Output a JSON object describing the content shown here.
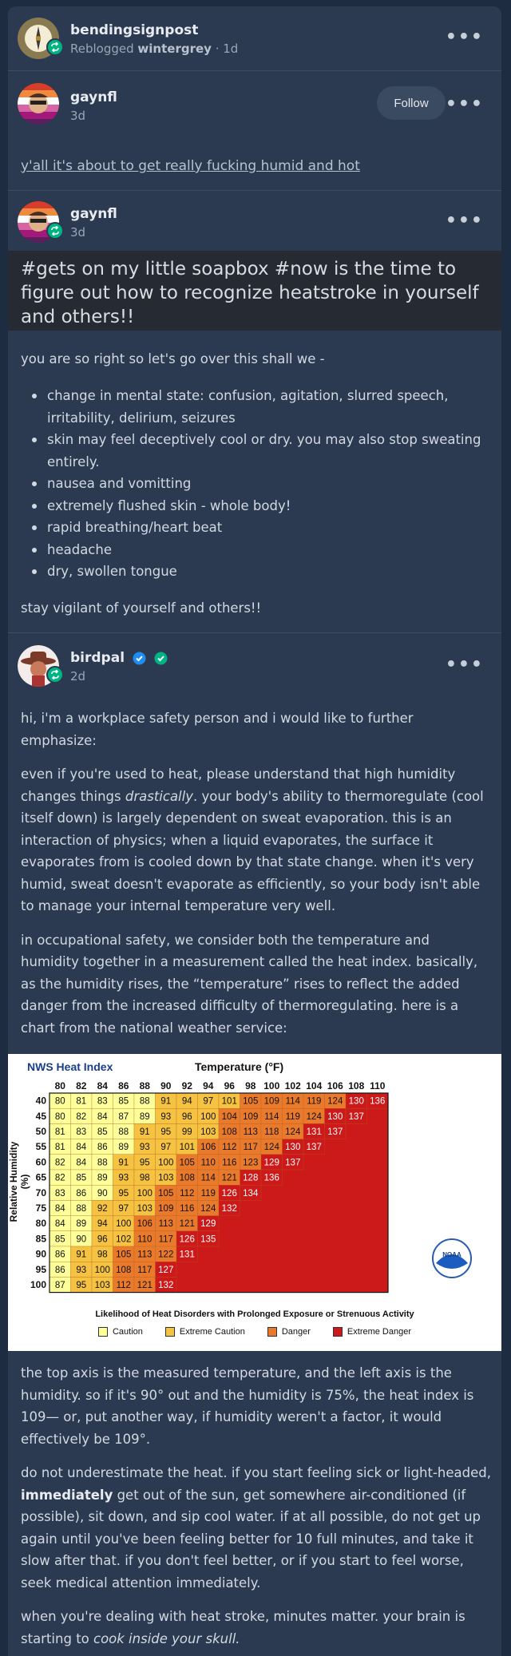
{
  "posts": {
    "reblogger": {
      "username": "bendingsignpost",
      "reblog_prefix": "Reblogged",
      "reblogged_from": "wintergrey",
      "age": "· 1d"
    },
    "op": {
      "username": "gaynfl",
      "age": "3d",
      "follow_label": "Follow",
      "text": "y'all it's about to get really fucking humid and hot"
    },
    "reblog1": {
      "username": "gaynfl",
      "age": "3d",
      "tags": "#gets on my little soapbox  #now is the time to figure out how to recognize heatstroke in yourself and others!!",
      "intro": "you are so right so let's go over this shall we -",
      "bullets": [
        "change in mental state: confusion, agitation, slurred speech, irritability, delirium, seizures",
        "skin may feel deceptively cool or dry. you may also stop sweating entirely.",
        "nausea and vomitting",
        "extremely flushed skin - whole body!",
        "rapid breathing/heart beat",
        "headache",
        "dry, swollen tongue"
      ],
      "outro": "stay vigilant of yourself and others!!"
    },
    "reblog2": {
      "username": "birdpal",
      "age": "2d",
      "p1": "hi, i'm a workplace safety person and i would like to further emphasize:",
      "p2a": "even if you're used to heat, please understand that high humidity changes things ",
      "p2em": "drastically",
      "p2b": ". your body's ability to thermoregulate (cool itself down) is largely dependent on sweat evaporation. this is an interaction of physics; when a liquid evaporates, the surface it evaporates from is cooled down by that state change. when it's very humid, sweat doesn't evaporate as efficiently, so your body isn't able to manage your internal temperature very well.",
      "p3": "in occupational safety, we consider both the temperature and humidity together in a measurement called the heat index. basically, as the humidity rises, the “temperature” rises to reflect the added danger from the increased difficulty of thermoregulating. here is a chart from the national weather service:",
      "p4": "the top axis is the measured temperature, and the left axis is the humidity. so if it's 90° out and the humidity is 75%, the heat index is 109— or, put another way, if humidity weren't a factor, it would effectively be 109°.",
      "p5a": "do not underestimate the heat. if you start feeling sick or light-headed, ",
      "p5b": "immediately",
      "p5c": " get out of the sun, get somewhere air-conditioned (if possible), sit down, and sip cool water. if at all possible, do not get up again until you've been feeling better for 10 full minutes, and take it slow after that. if you don't feel better, or if you start to feel worse, seek medical attention immediately.",
      "p6a": "when you're dealing with heat stroke, minutes matter. your brain is starting to ",
      "p6em": "cook inside your skull."
    }
  },
  "chart_data": {
    "type": "heatmap",
    "title": "NWS Heat Index",
    "xlabel": "Temperature (°F)",
    "ylabel": "Relative Humidity (%)",
    "x": [
      80,
      82,
      84,
      86,
      88,
      90,
      92,
      94,
      96,
      98,
      100,
      102,
      104,
      106,
      108,
      110
    ],
    "y": [
      40,
      45,
      50,
      55,
      60,
      65,
      70,
      75,
      80,
      85,
      90,
      95,
      100
    ],
    "values": [
      [
        80,
        81,
        83,
        85,
        88,
        91,
        94,
        97,
        101,
        105,
        109,
        114,
        119,
        124,
        130,
        136
      ],
      [
        80,
        82,
        84,
        87,
        89,
        93,
        96,
        100,
        104,
        109,
        114,
        119,
        124,
        130,
        137,
        null
      ],
      [
        81,
        83,
        85,
        88,
        91,
        95,
        99,
        103,
        108,
        113,
        118,
        124,
        131,
        137,
        null,
        null
      ],
      [
        81,
        84,
        86,
        89,
        93,
        97,
        101,
        106,
        112,
        117,
        124,
        130,
        137,
        null,
        null,
        null
      ],
      [
        82,
        84,
        88,
        91,
        95,
        100,
        105,
        110,
        116,
        123,
        129,
        137,
        null,
        null,
        null,
        null
      ],
      [
        82,
        85,
        89,
        93,
        98,
        103,
        108,
        114,
        121,
        128,
        136,
        null,
        null,
        null,
        null,
        null
      ],
      [
        83,
        86,
        90,
        95,
        100,
        105,
        112,
        119,
        126,
        134,
        null,
        null,
        null,
        null,
        null,
        null
      ],
      [
        84,
        88,
        92,
        97,
        103,
        109,
        116,
        124,
        132,
        null,
        null,
        null,
        null,
        null,
        null,
        null
      ],
      [
        84,
        89,
        94,
        100,
        106,
        113,
        121,
        129,
        null,
        null,
        null,
        null,
        null,
        null,
        null,
        null
      ],
      [
        85,
        90,
        96,
        102,
        110,
        117,
        126,
        135,
        null,
        null,
        null,
        null,
        null,
        null,
        null,
        null
      ],
      [
        86,
        91,
        98,
        105,
        113,
        122,
        131,
        null,
        null,
        null,
        null,
        null,
        null,
        null,
        null,
        null
      ],
      [
        86,
        93,
        100,
        108,
        117,
        127,
        null,
        null,
        null,
        null,
        null,
        null,
        null,
        null,
        null,
        null
      ],
      [
        87,
        95,
        103,
        112,
        121,
        132,
        null,
        null,
        null,
        null,
        null,
        null,
        null,
        null,
        null,
        null
      ]
    ],
    "legend_title": "Likelihood of Heat Disorders with Prolonged Exposure or Strenuous Activity",
    "legend": [
      {
        "label": "Caution",
        "color": "#ffff99",
        "range": [
          80,
          90
        ]
      },
      {
        "label": "Extreme Caution",
        "color": "#f5c242",
        "range": [
          91,
          103
        ]
      },
      {
        "label": "Danger",
        "color": "#ea7a2b",
        "range": [
          104,
          124
        ]
      },
      {
        "label": "Extreme Danger",
        "color": "#cc1a1a",
        "range": [
          125,
          137
        ]
      }
    ],
    "badge_text": "NOAA"
  }
}
